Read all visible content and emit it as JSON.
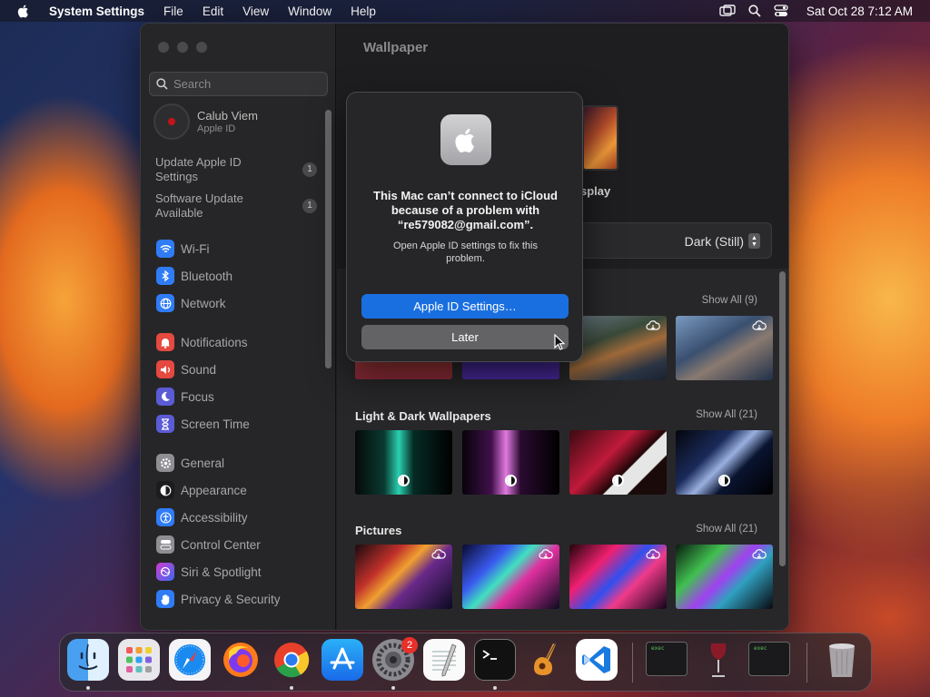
{
  "menubar": {
    "app_name": "System Settings",
    "menus": [
      "File",
      "Edit",
      "View",
      "Window",
      "Help"
    ],
    "clock": "Sat Oct 28  7:12 AM"
  },
  "sidebar": {
    "search_placeholder": "Search",
    "account": {
      "name": "Calub Viem",
      "subtitle": "Apple ID"
    },
    "notices": [
      {
        "label": "Update Apple ID Settings",
        "badge": "1"
      },
      {
        "label": "Software Update Available",
        "badge": "1"
      }
    ],
    "items": [
      {
        "label": "Wi-Fi",
        "icon": "wifi-icon",
        "color": "#2f7cf6"
      },
      {
        "label": "Bluetooth",
        "icon": "bluetooth-icon",
        "color": "#2f7cf6"
      },
      {
        "label": "Network",
        "icon": "globe-icon",
        "color": "#2f7cf6"
      },
      {
        "label": "Notifications",
        "icon": "bell-icon",
        "color": "#e5493f"
      },
      {
        "label": "Sound",
        "icon": "speaker-icon",
        "color": "#e5493f"
      },
      {
        "label": "Focus",
        "icon": "moon-icon",
        "color": "#5b5bd6"
      },
      {
        "label": "Screen Time",
        "icon": "hourglass-icon",
        "color": "#5b5bd6"
      },
      {
        "label": "General",
        "icon": "gear-icon",
        "color": "#8e8e93"
      },
      {
        "label": "Appearance",
        "icon": "appearance-icon",
        "color": "#1c1c1e"
      },
      {
        "label": "Accessibility",
        "icon": "accessibility-icon",
        "color": "#2f7cf6"
      },
      {
        "label": "Control Center",
        "icon": "control-center-icon",
        "color": "#8e8e93"
      },
      {
        "label": "Siri & Spotlight",
        "icon": "siri-icon",
        "color": "#b04ad9"
      },
      {
        "label": "Privacy & Security",
        "icon": "hand-icon",
        "color": "#2f7cf6"
      }
    ]
  },
  "content": {
    "title": "Wallpaper",
    "display_label": "splay",
    "appearance_value": "Dark (Still)",
    "sections": [
      {
        "title": "",
        "show_all": "Show All (9)"
      },
      {
        "title": "Light & Dark Wallpapers",
        "show_all": "Show All (21)"
      },
      {
        "title": "Pictures",
        "show_all": "Show All (21)"
      }
    ]
  },
  "dialog": {
    "heading": "This Mac can’t connect to iCloud because of a problem with “re579082@gmail.com”.",
    "body": "Open Apple ID settings to fix this problem.",
    "primary_button": "Apple ID Settings…",
    "secondary_button": "Later"
  },
  "dock": {
    "items": [
      {
        "name": "finder-icon",
        "running": true
      },
      {
        "name": "launchpad-icon",
        "running": false
      },
      {
        "name": "safari-icon",
        "running": false
      },
      {
        "name": "firefox-icon",
        "running": false
      },
      {
        "name": "chrome-icon",
        "running": true
      },
      {
        "name": "app-store-icon",
        "running": false
      },
      {
        "name": "system-settings-icon",
        "running": true,
        "badge": "2"
      },
      {
        "name": "textedit-icon",
        "running": false
      },
      {
        "name": "terminal-icon",
        "running": true
      },
      {
        "name": "garageband-icon",
        "running": false
      },
      {
        "name": "vscode-icon",
        "running": false
      },
      {
        "name": "exec-window-icon",
        "running": false,
        "label": "exec"
      },
      {
        "name": "wine-icon",
        "running": false
      },
      {
        "name": "exec-window-icon-2",
        "running": false,
        "label": "exec"
      },
      {
        "name": "trash-icon",
        "running": false
      }
    ]
  }
}
